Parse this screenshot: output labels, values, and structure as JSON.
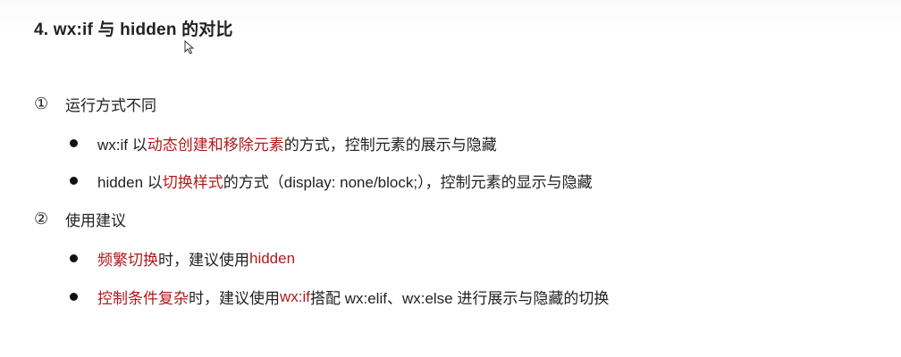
{
  "title": "4. wx:if 与 hidden 的对比",
  "sections": [
    {
      "num": "①",
      "heading": "运行方式不同",
      "bullets": [
        {
          "parts": [
            "wx:if 以",
            "动态创建和移除元素",
            "的方式，控制元素的展示与隐藏"
          ]
        },
        {
          "parts": [
            "hidden 以",
            "切换样式",
            "的方式（display: none/block;），控制元素的显示与隐藏"
          ]
        }
      ]
    },
    {
      "num": "②",
      "heading": "使用建议",
      "bullets": [
        {
          "parts": [
            "",
            "频繁切换",
            "时，建议使用 ",
            "hidden"
          ]
        },
        {
          "parts": [
            "",
            "控制条件复杂",
            "时，建议使用 ",
            "wx:if",
            " 搭配 wx:elif、wx:else 进行展示与隐藏的切换"
          ]
        }
      ]
    }
  ],
  "colors": {
    "text": "#222222",
    "highlight": "#b11a1a"
  },
  "icons": {
    "cursor": "mouse-pointer-icon",
    "bullet": "bullet-dot-icon"
  }
}
